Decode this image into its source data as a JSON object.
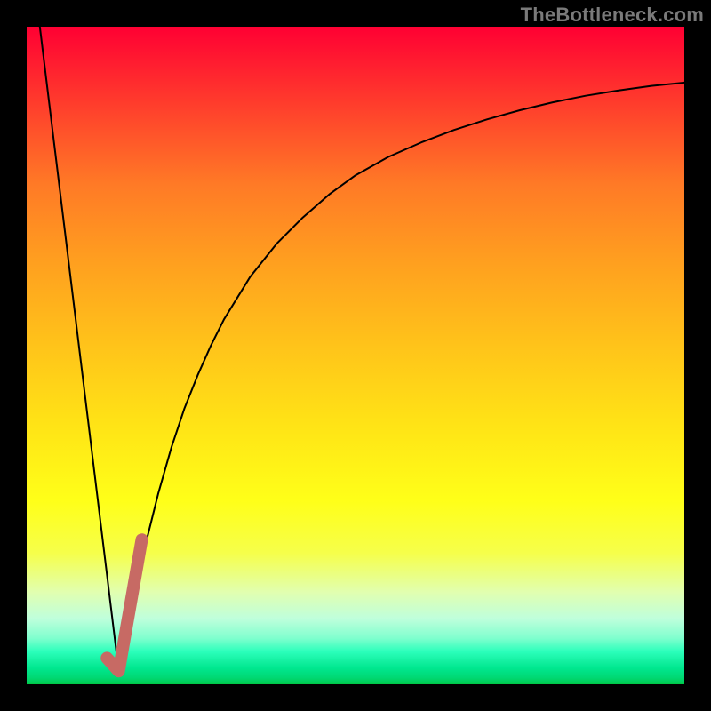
{
  "watermark": "TheBottleneck.com",
  "chart_data": {
    "type": "line",
    "title": "",
    "xlabel": "",
    "ylabel": "",
    "xlim": [
      0,
      100
    ],
    "ylim": [
      0,
      100
    ],
    "grid": false,
    "legend": false,
    "series": [
      {
        "name": "left-falling-line",
        "color": "#000000",
        "stroke_width": 2,
        "x": [
          2,
          14
        ],
        "y": [
          100,
          2
        ]
      },
      {
        "name": "rising-saturating-curve",
        "color": "#000000",
        "stroke_width": 2,
        "x": [
          14,
          16,
          18,
          20,
          22,
          24,
          26,
          28,
          30,
          34,
          38,
          42,
          46,
          50,
          55,
          60,
          65,
          70,
          75,
          80,
          85,
          90,
          95,
          100
        ],
        "y": [
          2,
          12,
          21,
          29,
          36,
          42,
          47,
          51.5,
          55.5,
          62,
          67,
          71,
          74.5,
          77.4,
          80.2,
          82.4,
          84.3,
          85.9,
          87.3,
          88.5,
          89.5,
          90.3,
          91,
          91.5
        ]
      },
      {
        "name": "dip-marker",
        "color": "#c76a64",
        "stroke_width": 14,
        "x": [
          12.2,
          14,
          17.5
        ],
        "y": [
          4,
          2,
          22
        ]
      }
    ]
  }
}
